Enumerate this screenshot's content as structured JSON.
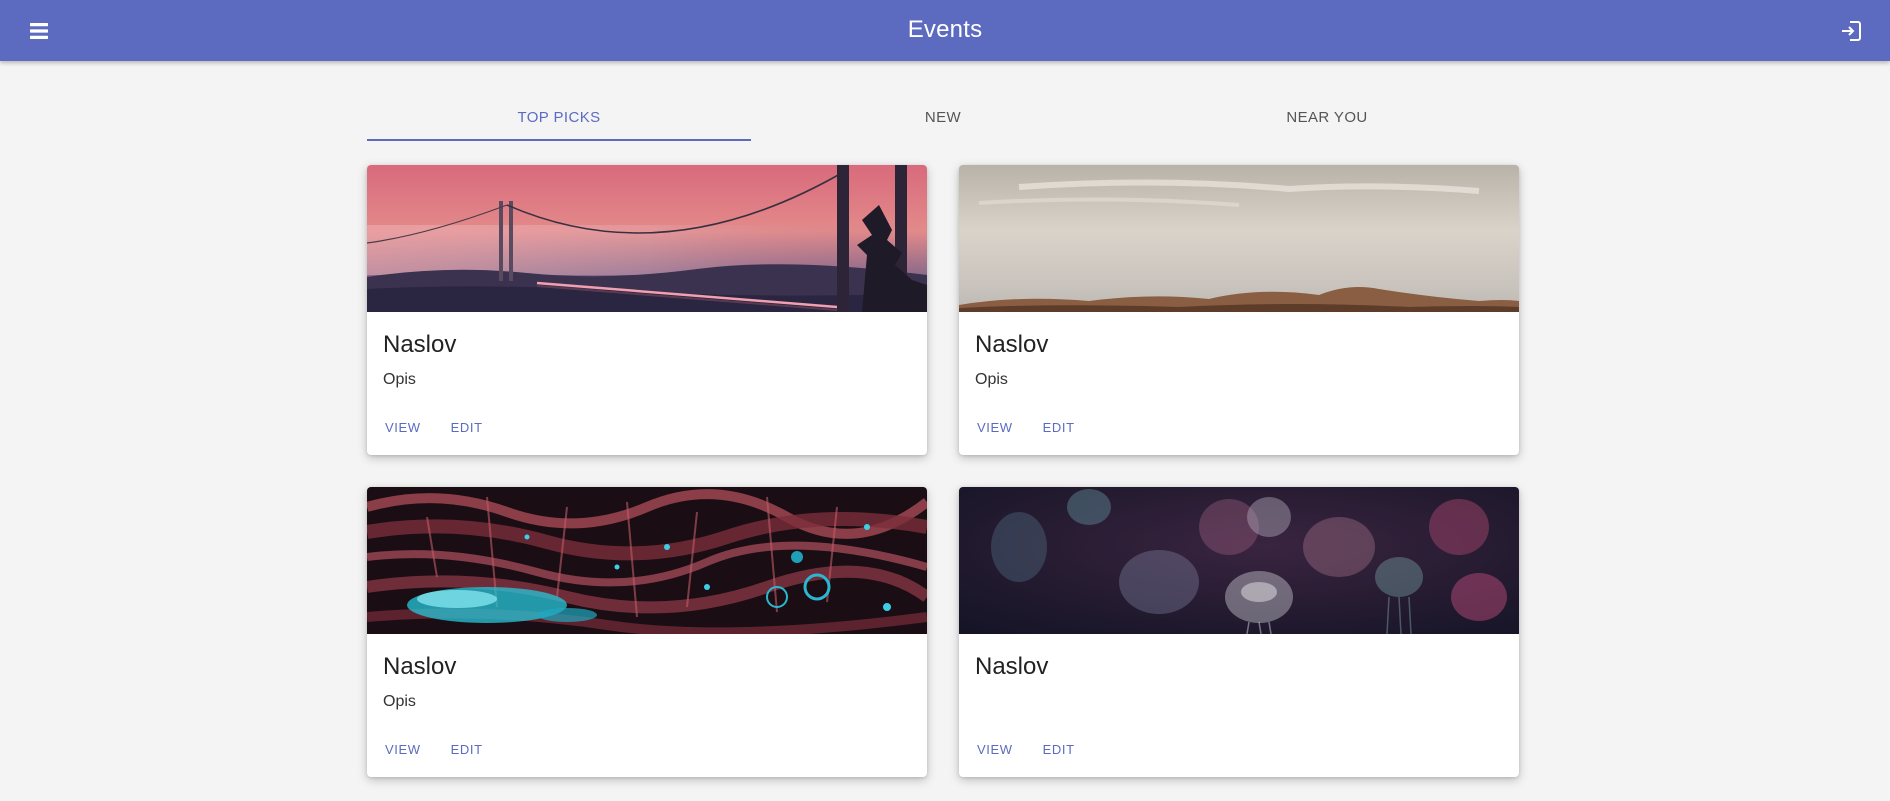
{
  "app_bar": {
    "title": "Events",
    "menu_icon": "menu-icon",
    "login_icon": "login-icon",
    "color": "#5c6bc0"
  },
  "tabs": [
    {
      "label": "TOP PICKS",
      "active": true
    },
    {
      "label": "NEW",
      "active": false
    },
    {
      "label": "NEAR YOU",
      "active": false
    }
  ],
  "cards": [
    {
      "title": "Naslov",
      "description": "Opis",
      "view_label": "VIEW",
      "edit_label": "EDIT",
      "image": "pink bridge in fog"
    },
    {
      "title": "Naslov",
      "description": "Opis",
      "view_label": "VIEW",
      "edit_label": "EDIT",
      "image": "desert dunes under hazy sky"
    },
    {
      "title": "Naslov",
      "description": "Opis",
      "view_label": "VIEW",
      "edit_label": "EDIT",
      "image": "red and cyan fluid abstract"
    },
    {
      "title": "Naslov",
      "description": "",
      "view_label": "VIEW",
      "edit_label": "EDIT",
      "image": "jellyfish in dark water"
    }
  ]
}
